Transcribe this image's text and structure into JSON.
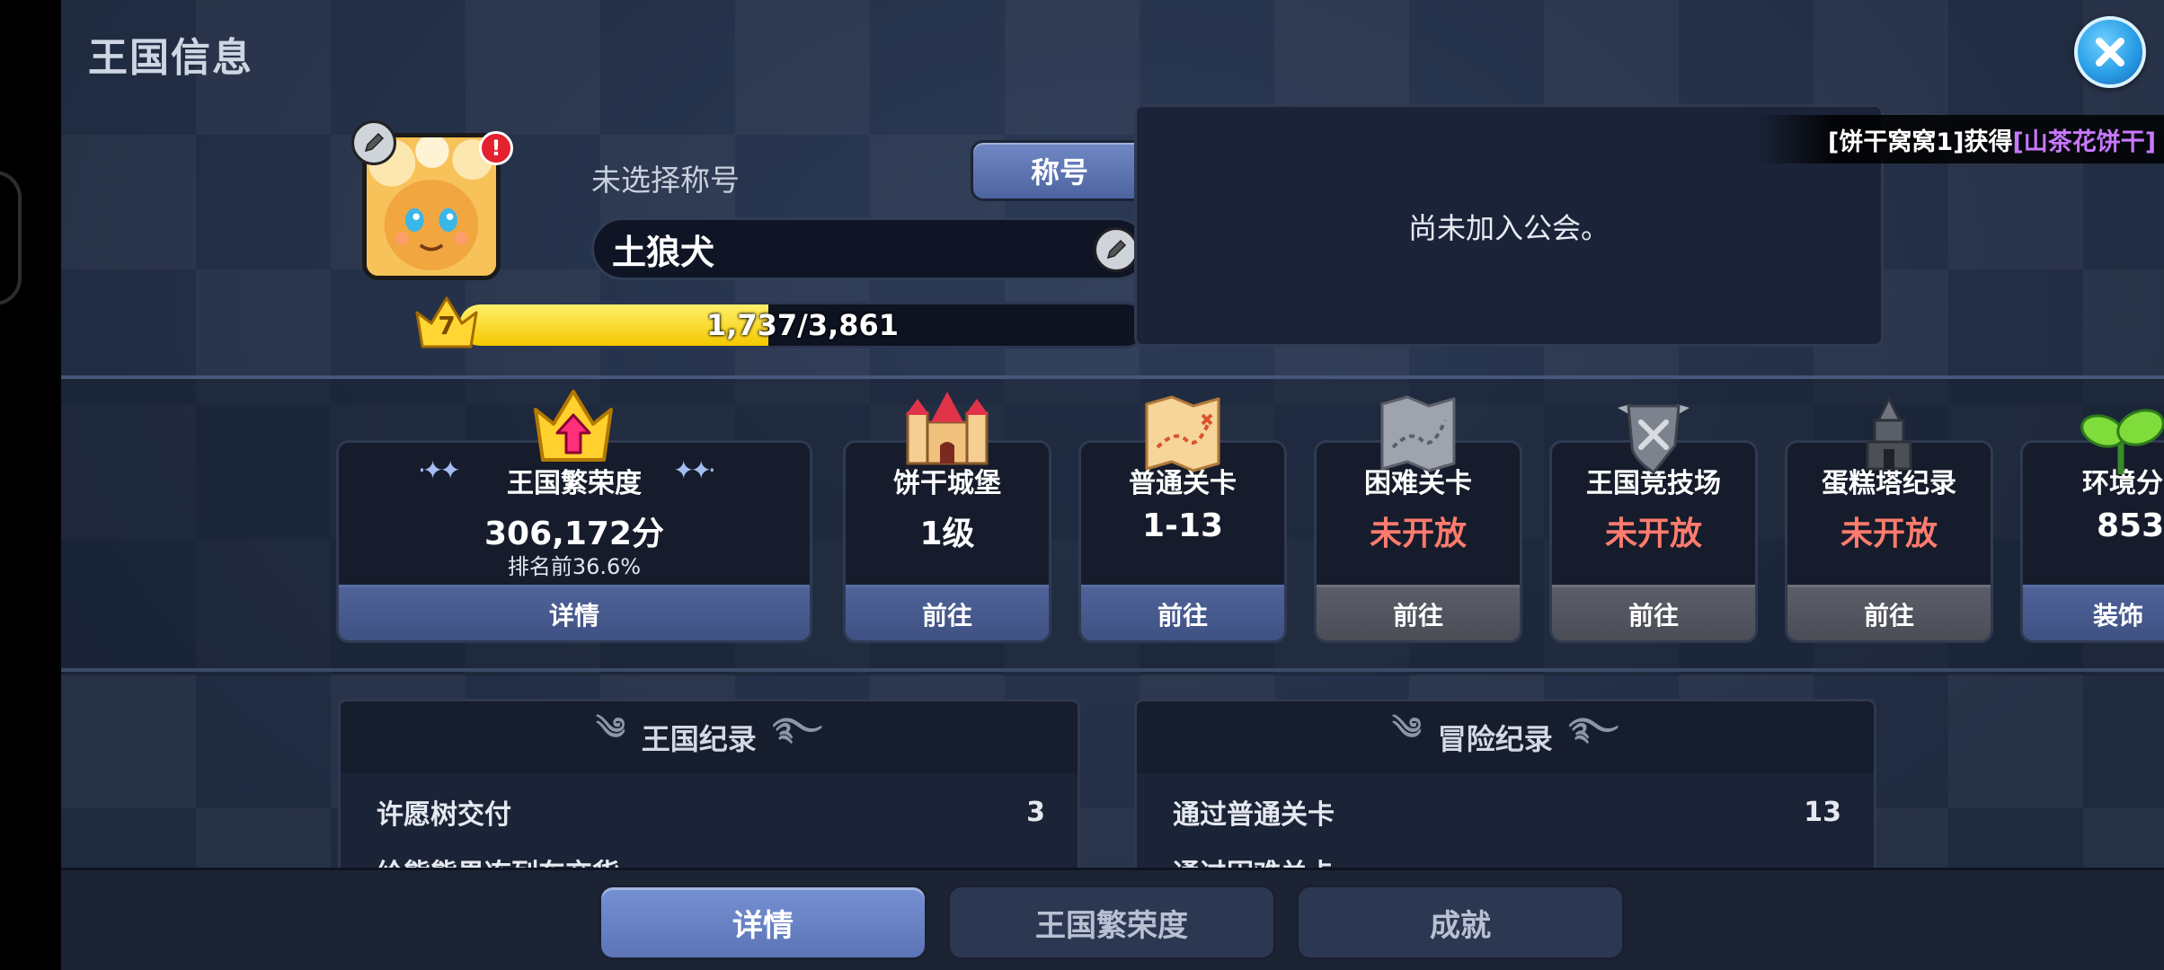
{
  "window": {
    "title": "王国信息"
  },
  "profile": {
    "title_status": "未选择称号",
    "title_button": "称号",
    "name": "土狼犬",
    "level": "7",
    "xp_text": "1,737/3,861",
    "xp_fraction": 0.45,
    "alert": "!"
  },
  "guild": {
    "status": "尚未加入公会。"
  },
  "ticker": {
    "prefix": "[饼干窝窝1]获得",
    "item": "[山茶花饼干]"
  },
  "cards": [
    {
      "label": "王国繁荣度",
      "value": "306,172分",
      "sub": "排名前36.6%",
      "button": "详情"
    },
    {
      "label": "饼干城堡",
      "value": "1级",
      "button": "前往"
    },
    {
      "label": "普通关卡",
      "value": "1-13",
      "button": "前往"
    },
    {
      "label": "困难关卡",
      "value": "未开放",
      "button": "前往"
    },
    {
      "label": "王国竞技场",
      "value": "未开放",
      "button": "前往"
    },
    {
      "label": "蛋糕塔纪录",
      "value": "未开放",
      "button": "前往"
    },
    {
      "label": "环境分",
      "value": "853",
      "button": "装饰"
    }
  ],
  "kingdom_record": {
    "header": "王国纪录",
    "rows": [
      {
        "label": "许愿树交付",
        "value": "3"
      },
      {
        "label": "给熊熊果冻列车交货",
        "value": ""
      }
    ]
  },
  "adventure_record": {
    "header": "冒险纪录",
    "rows": [
      {
        "label": "通过普通关卡",
        "value": "13"
      },
      {
        "label": "通过困难关卡",
        "value": ""
      }
    ]
  },
  "tabs": [
    "详情",
    "王国繁荣度",
    "成就"
  ],
  "colors": {
    "accent_blue": "#5c74b6",
    "locked_red": "#ff7b6e",
    "xp_yellow": "#f5c800",
    "ticker_purple": "#c878ff"
  }
}
